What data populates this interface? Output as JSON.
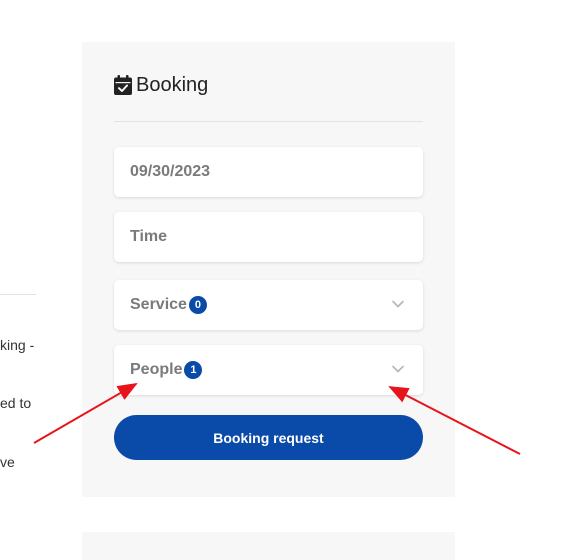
{
  "background_text": {
    "line1": "king -",
    "line2": "ed to",
    "line3": "ve"
  },
  "booking": {
    "title": "Booking",
    "icon": "calendar-check-icon",
    "date_value": "09/30/2023",
    "time_placeholder": "Time",
    "service_label": "Service",
    "service_count": "0",
    "people_label": "People",
    "people_count": "1",
    "submit_label": "Booking request"
  },
  "annotations": {
    "arrow_color": "#e8141b"
  },
  "colors": {
    "primary": "#0a4aa8",
    "panel_bg": "#f7f7f7"
  }
}
